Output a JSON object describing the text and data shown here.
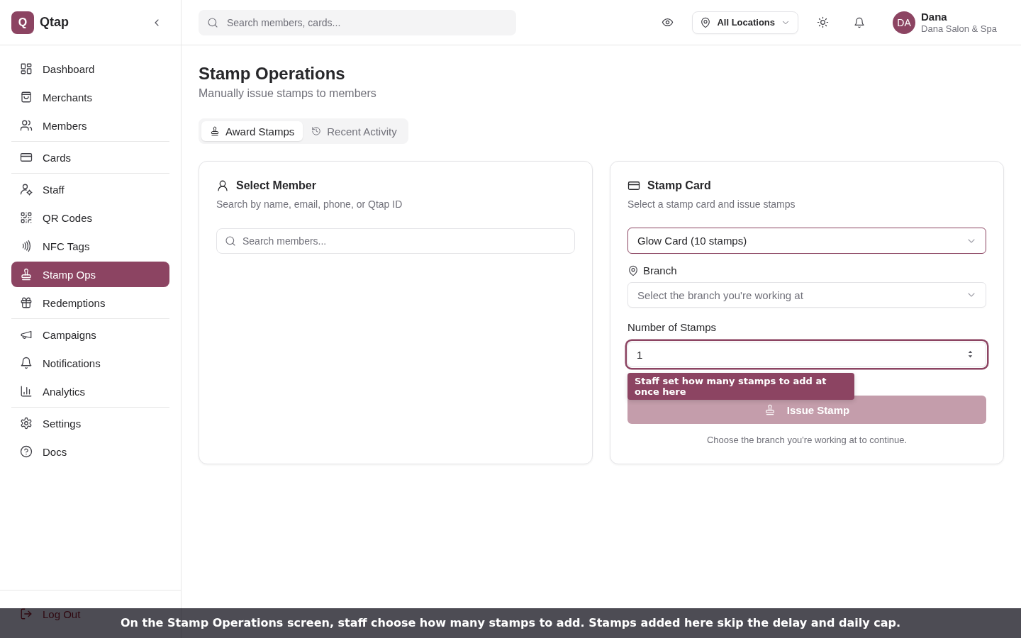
{
  "brand": {
    "logo_letter": "Q",
    "name": "Qtap"
  },
  "sidebar": {
    "groups": [
      {
        "items": [
          {
            "label": "Dashboard",
            "selected": false
          },
          {
            "label": "Merchants",
            "selected": false
          },
          {
            "label": "Members",
            "selected": false
          }
        ]
      },
      {
        "items": [
          {
            "label": "Cards",
            "selected": false
          }
        ]
      },
      {
        "items": [
          {
            "label": "Staff",
            "selected": false
          },
          {
            "label": "QR Codes",
            "selected": false
          },
          {
            "label": "NFC Tags",
            "selected": false
          },
          {
            "label": "Stamp Ops",
            "selected": true
          },
          {
            "label": "Redemptions",
            "selected": false
          }
        ]
      },
      {
        "items": [
          {
            "label": "Campaigns",
            "selected": false
          },
          {
            "label": "Notifications",
            "selected": false
          },
          {
            "label": "Analytics",
            "selected": false
          }
        ]
      },
      {
        "items": [
          {
            "label": "Settings",
            "selected": false
          },
          {
            "label": "Docs",
            "selected": false
          }
        ]
      }
    ],
    "logout": {
      "label": "Log Out"
    }
  },
  "topbar": {
    "search": {
      "placeholder": "Search members, cards..."
    },
    "location_filter": {
      "label": "All Locations"
    },
    "user": {
      "initials": "DA",
      "name": "Dana",
      "business": "Dana Salon & Spa"
    }
  },
  "page": {
    "title": "Stamp Operations",
    "subtitle": "Manually issue stamps to members"
  },
  "tabs": [
    {
      "label": "Award Stamps",
      "selected": true
    },
    {
      "label": "Recent Activity",
      "selected": false
    }
  ],
  "member_panel": {
    "title": "Select Member",
    "description": "Search by name, email, phone, or Qtap ID",
    "search": {
      "placeholder": "Search members..."
    }
  },
  "card_panel": {
    "title": "Stamp Card",
    "description": "Select a stamp card and issue stamps",
    "card_select": {
      "value": "Glow Card (10 stamps)"
    },
    "branch": {
      "label": "Branch",
      "placeholder": "Select the branch you're working at"
    },
    "stamps": {
      "label": "Number of Stamps",
      "value": "1",
      "focused": true
    },
    "issue_button": {
      "label": "Issue Stamp",
      "disabled": true
    },
    "hint": "Choose the branch you're working at to continue."
  },
  "tooltip": {
    "text": "Staff set how many stamps to add at once here"
  },
  "caption": {
    "text": "On the Stamp Operations screen, staff choose how many stamps to add. Stamps added here skip the delay and daily cap."
  }
}
